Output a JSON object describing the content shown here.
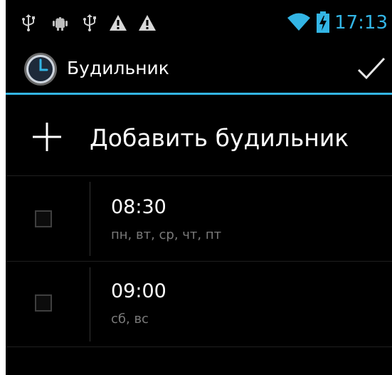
{
  "status_bar": {
    "time": "17:13",
    "icons": [
      "usb-icon",
      "android-debug-icon",
      "usb-icon",
      "warning-icon",
      "warning-icon",
      "wifi-icon",
      "battery-charging-icon"
    ],
    "accent_color": "#33b5e5"
  },
  "action_bar": {
    "title": "Будильник",
    "app_icon": "clock-icon",
    "done_icon": "checkmark-icon"
  },
  "add_alarm": {
    "label": "Добавить будильник",
    "icon": "plus-icon"
  },
  "alarms": [
    {
      "time": "08:30",
      "days": "пн, вт, ср, чт, пт",
      "enabled": false
    },
    {
      "time": "09:00",
      "days": "сб, вс",
      "enabled": false
    }
  ]
}
